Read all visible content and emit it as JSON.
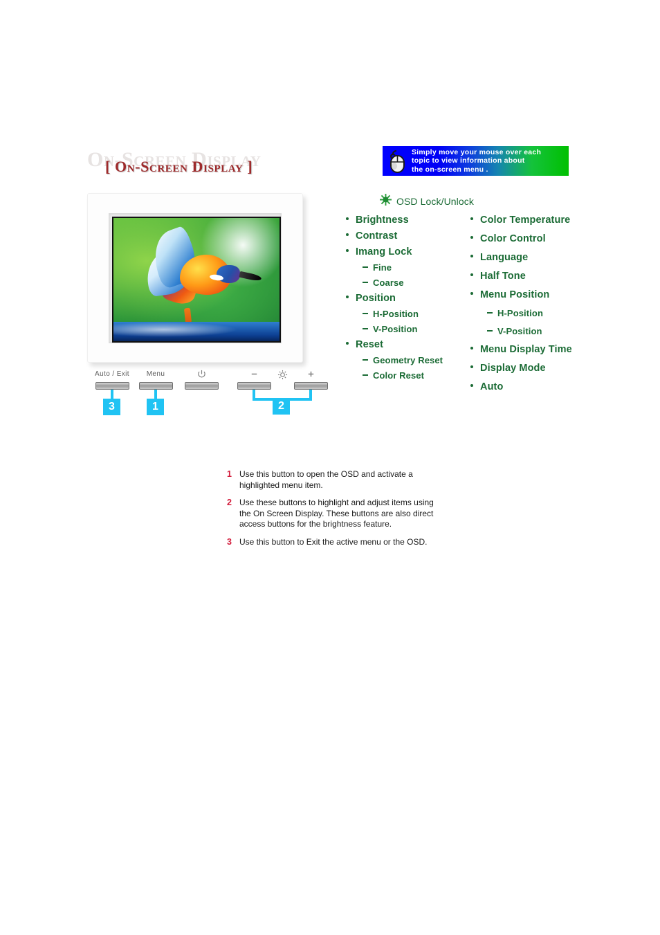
{
  "page": {
    "title_watermark": "On-Screen Display",
    "title_main": "[ On-Screen Display ]"
  },
  "hint_banner": {
    "icon": "mouse-icon",
    "text": "Simply move your mouse over each\ntopic to view information about\nthe on-screen menu .",
    "gradient_start": "#0000ff",
    "gradient_end": "#00c000"
  },
  "osd_lock": {
    "icon": "sun-burst-icon",
    "label": "OSD Lock/Unlock",
    "color": "#1b6b35"
  },
  "monitor": {
    "screen_image": "kingfisher-bird-photo",
    "buttons": [
      {
        "label": "Auto / Exit",
        "icon": "",
        "callout": "3"
      },
      {
        "label": "Menu",
        "icon": "",
        "callout": "1"
      },
      {
        "label": "",
        "icon": "power-icon",
        "callout": ""
      },
      {
        "label": "",
        "icon": "minus-icon",
        "callout": "2"
      },
      {
        "label": "",
        "icon": "brightness-sun-icon",
        "callout": ""
      },
      {
        "label": "",
        "icon": "plus-icon",
        "callout": "2"
      }
    ],
    "callouts": [
      {
        "number": "3"
      },
      {
        "number": "1"
      },
      {
        "number": "2"
      }
    ],
    "callout_color": "#20c3f3"
  },
  "menu": {
    "accent_color": "#1b6b35",
    "left_column": [
      {
        "level": 1,
        "label": "Brightness"
      },
      {
        "level": 1,
        "label": "Contrast"
      },
      {
        "level": 1,
        "label": "Imang Lock"
      },
      {
        "level": 2,
        "label": "Fine"
      },
      {
        "level": 2,
        "label": "Coarse"
      },
      {
        "level": 1,
        "label": "Position"
      },
      {
        "level": 2,
        "label": "H-Position"
      },
      {
        "level": 2,
        "label": "V-Position"
      },
      {
        "level": 1,
        "label": "Reset"
      },
      {
        "level": 2,
        "label": "Geometry Reset"
      },
      {
        "level": 2,
        "label": "Color Reset"
      }
    ],
    "right_column": [
      {
        "level": 1,
        "label": "Color Temperature"
      },
      {
        "level": 1,
        "label": "Color Control"
      },
      {
        "level": 1,
        "label": "Language"
      },
      {
        "level": 1,
        "label": "Half Tone"
      },
      {
        "level": 1,
        "label": "Menu Position"
      },
      {
        "level": 2,
        "label": "H-Position"
      },
      {
        "level": 2,
        "label": "V-Position"
      },
      {
        "level": 1,
        "label": "Menu Display Time"
      },
      {
        "level": 1,
        "label": "Display Mode"
      },
      {
        "level": 1,
        "label": "Auto"
      }
    ]
  },
  "instructions": {
    "number_color": "#d31d3c",
    "rows": [
      {
        "number": "1",
        "text": "Use this button to open the OSD and activate a\nhighlighted menu item."
      },
      {
        "number": "2",
        "text": "Use these buttons to highlight and adjust items using\nthe On Screen Display. These buttons are also direct\naccess buttons for the brightness feature."
      },
      {
        "number": "3",
        "text": "Use this button to Exit the active menu or the OSD."
      }
    ]
  }
}
